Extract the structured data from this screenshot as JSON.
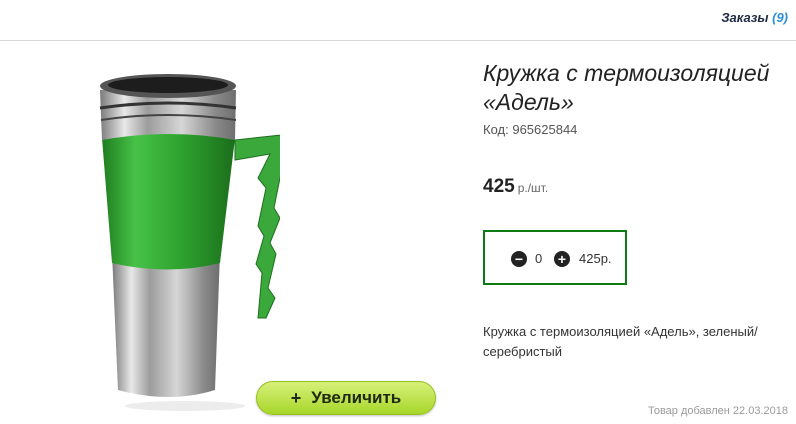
{
  "header": {
    "orders_label": "Заказы",
    "orders_count": "(9)"
  },
  "product": {
    "title": "Кружка с термоизоляцией «Адель»",
    "code_label": "Код:",
    "code": "965625844",
    "price": "425",
    "price_unit": "р./шт.",
    "quantity": "0",
    "total": "425р.",
    "description": "Кружка с термоизоляцией «Адель», зеленый/серебристый",
    "added_date": "Товар добавлен 22.03.2018",
    "image_icon": "thermo-mug-image",
    "colors": {
      "band": "#3aa83a",
      "steel": "#b9b9b9"
    }
  },
  "zoom": {
    "icon": "+",
    "label": "Увеличить"
  },
  "cart": {
    "minus_icon": "−",
    "plus_icon": "+",
    "border_color": "#0d7a16"
  }
}
